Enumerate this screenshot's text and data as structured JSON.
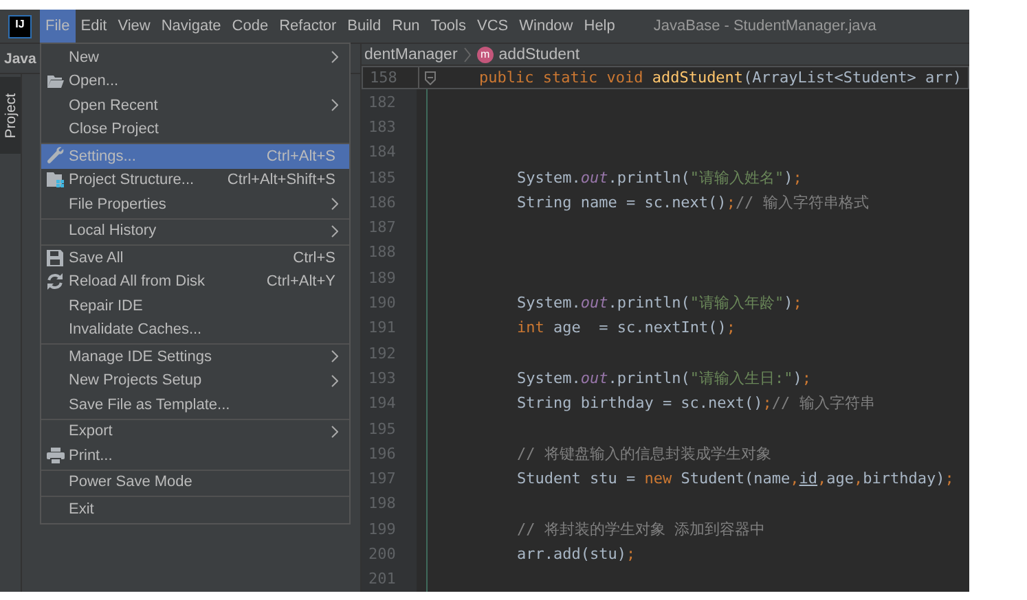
{
  "menu_bar": {
    "logo_text": "IJ",
    "items": [
      {
        "label": "File",
        "selected": true
      },
      {
        "label": "Edit",
        "selected": false
      },
      {
        "label": "View",
        "selected": false
      },
      {
        "label": "Navigate",
        "selected": false
      },
      {
        "label": "Code",
        "selected": false
      },
      {
        "label": "Refactor",
        "selected": false
      },
      {
        "label": "Build",
        "selected": false
      },
      {
        "label": "Run",
        "selected": false
      },
      {
        "label": "Tools",
        "selected": false
      },
      {
        "label": "VCS",
        "selected": false
      },
      {
        "label": "Window",
        "selected": false
      },
      {
        "label": "Help",
        "selected": false
      }
    ],
    "title": "JavaBase - StudentManager.java"
  },
  "tool_window": {
    "header": "Java",
    "stripe_label": "Project"
  },
  "breadcrumb": {
    "class_name": "dentManager",
    "method_badge": "m",
    "method_name": "addStudent"
  },
  "editor": {
    "sticky_line": {
      "number": "158",
      "tokens": [
        {
          "kind": "keyword",
          "text": "    public static void "
        },
        {
          "kind": "method",
          "text": "addStudent"
        },
        {
          "kind": "plain",
          "text": "(ArrayList<Student> arr)"
        }
      ]
    },
    "lines": [
      {
        "number": "182"
      },
      {
        "number": "183"
      },
      {
        "number": "184"
      },
      {
        "number": "185",
        "tokens": [
          {
            "kind": "plain",
            "text": "        System."
          },
          {
            "kind": "field",
            "text": "out"
          },
          {
            "kind": "plain",
            "text": ".println("
          },
          {
            "kind": "string",
            "text": "\"请输入姓名\""
          },
          {
            "kind": "plain",
            "text": ")"
          },
          {
            "kind": "keyword",
            "text": ";"
          }
        ]
      },
      {
        "number": "186",
        "tokens": [
          {
            "kind": "plain",
            "text": "        String name = sc.next()"
          },
          {
            "kind": "keyword",
            "text": ";"
          },
          {
            "kind": "comment",
            "text": "// 输入字符串格式"
          }
        ]
      },
      {
        "number": "187"
      },
      {
        "number": "188"
      },
      {
        "number": "189"
      },
      {
        "number": "190",
        "tokens": [
          {
            "kind": "plain",
            "text": "        System."
          },
          {
            "kind": "field",
            "text": "out"
          },
          {
            "kind": "plain",
            "text": ".println("
          },
          {
            "kind": "string",
            "text": "\"请输入年龄\""
          },
          {
            "kind": "plain",
            "text": ")"
          },
          {
            "kind": "keyword",
            "text": ";"
          }
        ]
      },
      {
        "number": "191",
        "tokens": [
          {
            "kind": "keyword",
            "text": "        int"
          },
          {
            "kind": "plain",
            "text": " age  = sc.nextInt()"
          },
          {
            "kind": "keyword",
            "text": ";"
          }
        ]
      },
      {
        "number": "192"
      },
      {
        "number": "193",
        "tokens": [
          {
            "kind": "plain",
            "text": "        System."
          },
          {
            "kind": "field",
            "text": "out"
          },
          {
            "kind": "plain",
            "text": ".println("
          },
          {
            "kind": "string",
            "text": "\"请输入生日:\""
          },
          {
            "kind": "plain",
            "text": ")"
          },
          {
            "kind": "keyword",
            "text": ";"
          }
        ]
      },
      {
        "number": "194",
        "tokens": [
          {
            "kind": "plain",
            "text": "        String birthday = sc.next()"
          },
          {
            "kind": "keyword",
            "text": ";"
          },
          {
            "kind": "comment",
            "text": "// 输入字符串"
          }
        ]
      },
      {
        "number": "195"
      },
      {
        "number": "196",
        "tokens": [
          {
            "kind": "comment",
            "text": "        // 将键盘输入的信息封装成学生对象"
          }
        ]
      },
      {
        "number": "197",
        "tokens": [
          {
            "kind": "plain",
            "text": "        Student stu = "
          },
          {
            "kind": "keyword",
            "text": "new"
          },
          {
            "kind": "plain",
            "text": " Student(name"
          },
          {
            "kind": "keyword",
            "text": ","
          },
          {
            "kind": "warning",
            "text": "id"
          },
          {
            "kind": "keyword",
            "text": ","
          },
          {
            "kind": "plain",
            "text": "age"
          },
          {
            "kind": "keyword",
            "text": ","
          },
          {
            "kind": "plain",
            "text": "birthday)"
          },
          {
            "kind": "keyword",
            "text": ";"
          }
        ]
      },
      {
        "number": "198"
      },
      {
        "number": "199",
        "tokens": [
          {
            "kind": "comment",
            "text": "        // 将封装的学生对象 添加到容器中"
          }
        ]
      },
      {
        "number": "200",
        "tokens": [
          {
            "kind": "plain",
            "text": "        arr.add(stu)"
          },
          {
            "kind": "keyword",
            "text": ";"
          }
        ]
      },
      {
        "number": "201"
      }
    ]
  },
  "file_menu": {
    "items": [
      {
        "label": "New",
        "submenu": true,
        "separator_before": false,
        "selected": false
      },
      {
        "label": "Open...",
        "kind": "folder",
        "submenu": false,
        "separator_before": false,
        "selected": false
      },
      {
        "label": "Open Recent",
        "submenu": true,
        "separator_before": false,
        "selected": false
      },
      {
        "label": "Close Project",
        "submenu": false,
        "separator_before": false,
        "selected": false
      },
      {
        "label": "Settings...",
        "kind": "wrench",
        "shortcut": "Ctrl+Alt+S",
        "submenu": false,
        "separator_before": true,
        "selected": true
      },
      {
        "label": "Project Structure...",
        "kind": "structure",
        "shortcut": "Ctrl+Alt+Shift+S",
        "submenu": false,
        "separator_before": false,
        "selected": false
      },
      {
        "label": "File Properties",
        "submenu": true,
        "separator_before": false,
        "selected": false
      },
      {
        "label": "Local History",
        "submenu": true,
        "separator_before": true,
        "selected": false
      },
      {
        "label": "Save All",
        "kind": "floppy",
        "shortcut": "Ctrl+S",
        "submenu": false,
        "separator_before": true,
        "selected": false
      },
      {
        "label": "Reload All from Disk",
        "kind": "reload",
        "shortcut": "Ctrl+Alt+Y",
        "submenu": false,
        "separator_before": false,
        "selected": false
      },
      {
        "label": "Repair IDE",
        "submenu": false,
        "separator_before": false,
        "selected": false
      },
      {
        "label": "Invalidate Caches...",
        "submenu": false,
        "separator_before": false,
        "selected": false
      },
      {
        "label": "Manage IDE Settings",
        "submenu": true,
        "separator_before": true,
        "selected": false
      },
      {
        "label": "New Projects Setup",
        "submenu": true,
        "separator_before": false,
        "selected": false
      },
      {
        "label": "Save File as Template...",
        "submenu": false,
        "separator_before": false,
        "selected": false
      },
      {
        "label": "Export",
        "submenu": true,
        "separator_before": true,
        "selected": false
      },
      {
        "label": "Print...",
        "kind": "printer",
        "submenu": false,
        "separator_before": false,
        "selected": false
      },
      {
        "label": "Power Save Mode",
        "submenu": false,
        "separator_before": true,
        "selected": false
      },
      {
        "label": "Exit",
        "submenu": false,
        "separator_before": true,
        "selected": false
      }
    ]
  }
}
